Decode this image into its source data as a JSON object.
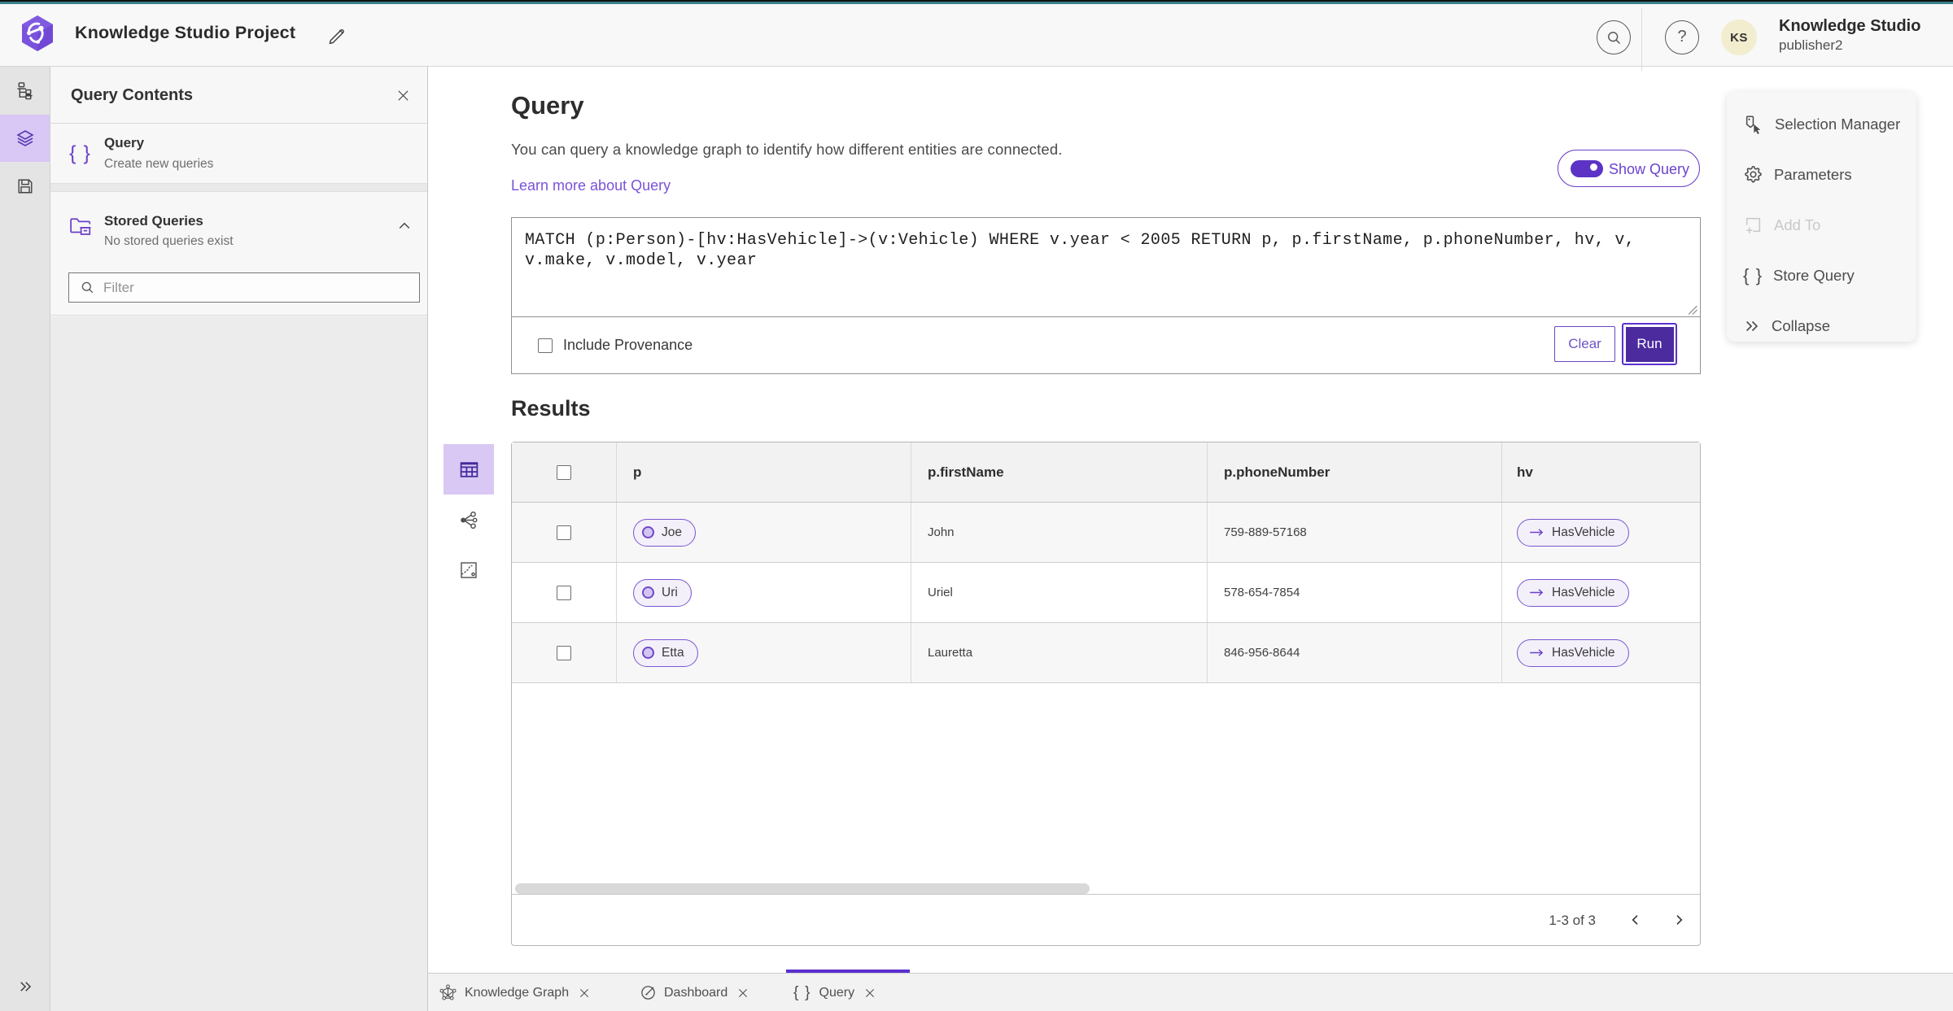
{
  "header": {
    "app_title": "Knowledge Studio Project",
    "user": {
      "name": "Knowledge Studio",
      "role": "publisher2",
      "initials": "KS"
    }
  },
  "panel": {
    "title": "Query Contents",
    "query_item": {
      "title": "Query",
      "subtitle": "Create new queries"
    },
    "stored_item": {
      "title": "Stored Queries",
      "subtitle": "No stored queries exist"
    },
    "filter_placeholder": "Filter"
  },
  "query": {
    "heading": "Query",
    "description": "You can query a knowledge graph to identify how different entities are connected.",
    "learn_more_label": "Learn more about Query",
    "show_query_label": "Show Query",
    "editor_text": "MATCH (p:Person)-[hv:HasVehicle]->(v:Vehicle) WHERE v.year < 2005 RETURN p, p.firstName, p.phoneNumber, hv, v, v.make, v.model, v.year",
    "include_provenance_label": "Include Provenance",
    "clear_label": "Clear",
    "run_label": "Run"
  },
  "results": {
    "heading": "Results",
    "columns": {
      "p": "p",
      "first_name": "p.firstName",
      "phone": "p.phoneNumber",
      "hv": "hv"
    },
    "rows": [
      {
        "p": "Joe",
        "first_name": "John",
        "phone": "759-889-57168",
        "hv": "HasVehicle"
      },
      {
        "p": "Uri",
        "first_name": "Uriel",
        "phone": "578-654-7854",
        "hv": "HasVehicle"
      },
      {
        "p": "Etta",
        "first_name": "Lauretta",
        "phone": "846-956-8644",
        "hv": "HasVehicle"
      }
    ],
    "pagination_label": "1-3 of 3"
  },
  "action_menu": {
    "selection_manager": "Selection Manager",
    "parameters": "Parameters",
    "add_to": "Add To",
    "store_query": "Store Query",
    "collapse": "Collapse"
  },
  "tabs": {
    "knowledge_graph": "Knowledge Graph",
    "dashboard": "Dashboard",
    "query": "Query"
  },
  "icons": {
    "braces_glyph": "{ }",
    "help_glyph": "?"
  },
  "colors": {
    "accent": "#6b40c9",
    "accent_dark": "#4b2b9e",
    "teal_bar": "#377f89",
    "selected_bg": "#d9c7f5",
    "link": "#7a52d9"
  }
}
